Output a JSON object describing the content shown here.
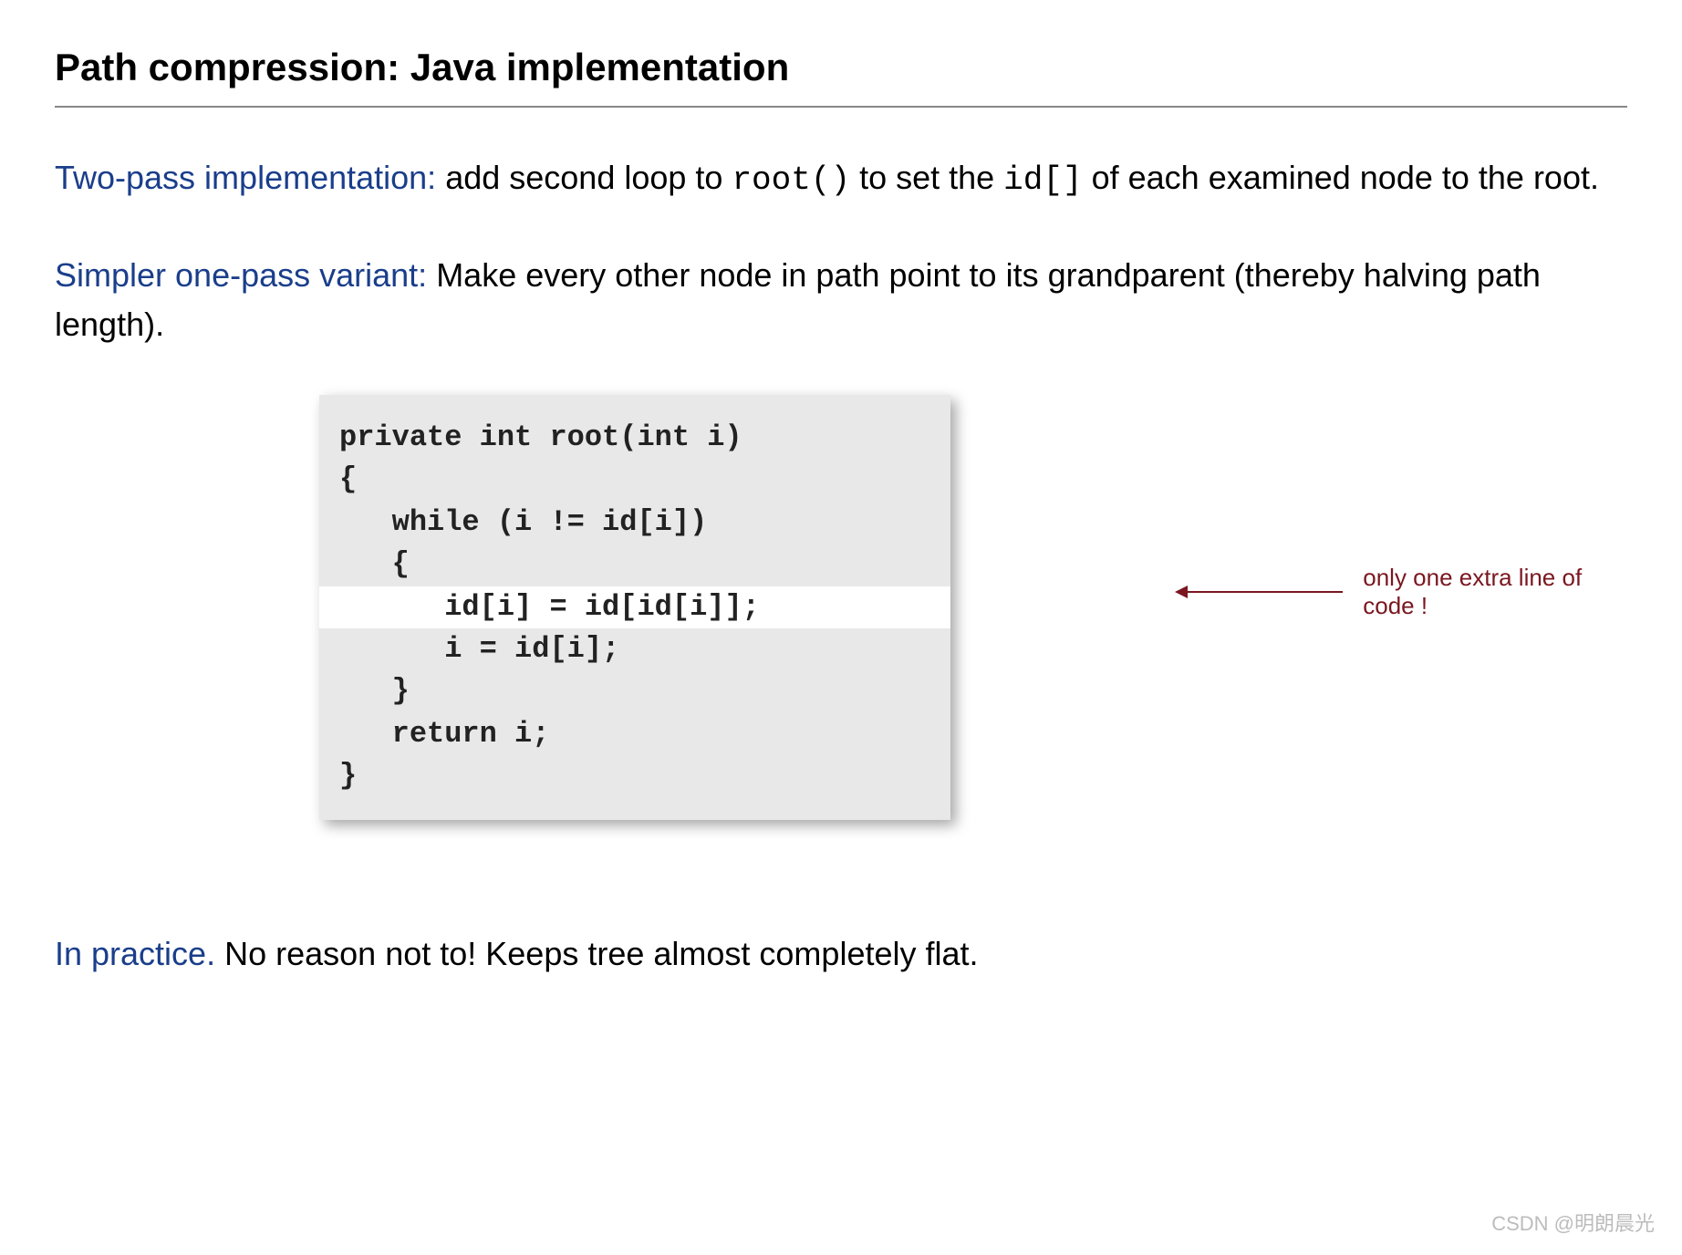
{
  "title": "Path compression:  Java implementation",
  "section1": {
    "label": "Two-pass implementation:",
    "text_before_code1": "  add second loop to ",
    "code1": "root()",
    "text_mid": " to set the ",
    "code2": "id[]",
    "text_after": " of each examined node to the root."
  },
  "section2": {
    "label": "Simpler one-pass variant:",
    "text": "  Make every other node in path point to its grandparent (thereby halving path length)."
  },
  "code": {
    "l1": "private int root(int i)",
    "l2": "{",
    "l3": "   while (i != id[i])",
    "l4": "   {",
    "l5": "      id[i] = id[id[i]];",
    "l6": "      i = id[i];",
    "l7": "   }",
    "l8": "   return i;",
    "l9": "}"
  },
  "annotation": "only one extra line of code !",
  "section3": {
    "label": "In practice.",
    "text": "  No reason not to!  Keeps tree almost completely flat."
  },
  "watermark": "CSDN @明朗晨光"
}
